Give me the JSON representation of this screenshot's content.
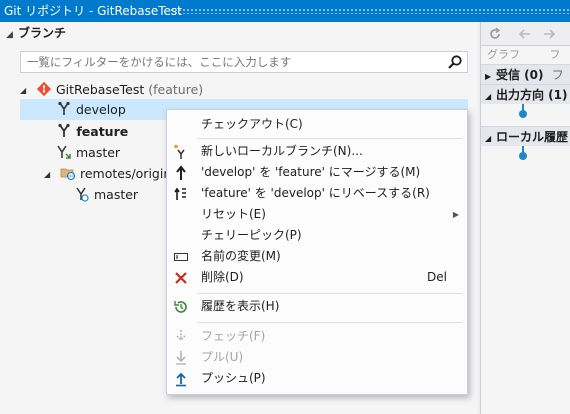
{
  "window": {
    "title": "Git リポジトリ - GitRebaseTest"
  },
  "branches": {
    "header": "ブランチ",
    "filter_placeholder": "一覧にフィルターをかけるには、ここに入力します",
    "repo": {
      "name": "GitRebaseTest",
      "current": "(feature)"
    },
    "items": [
      {
        "name": "develop"
      },
      {
        "name": "feature"
      },
      {
        "name": "master"
      }
    ],
    "remote": {
      "name": "remotes/origin",
      "items": [
        {
          "name": "master"
        }
      ]
    }
  },
  "right_panel": {
    "graph_label": "グラフ",
    "graph_label_2": "フ",
    "incoming": "受信 (0)",
    "incoming_suffix": "フ",
    "outgoing": "出力方向 (1)",
    "local_history": "ローカル履歴"
  },
  "context_menu": {
    "checkout": "チェックアウト(C)",
    "new_branch": "新しいローカルブランチ(N)...",
    "merge": "'develop' を 'feature' にマージする(M)",
    "rebase": "'feature' を 'develop' にリベースする(R)",
    "reset": "リセット(E)",
    "cherry_pick": "チェリーピック(P)",
    "rename": "名前の変更(M)",
    "delete": "削除(D)",
    "delete_shortcut": "Del",
    "history": "履歴を表示(H)",
    "fetch": "フェッチ(F)",
    "pull": "プル(U)",
    "push": "プッシュ(P)"
  },
  "colors": {
    "accent": "#007acc",
    "selection": "#cce8ff",
    "delete": "#c42b1c",
    "green": "#388a34",
    "graph": "#1e88c9"
  }
}
